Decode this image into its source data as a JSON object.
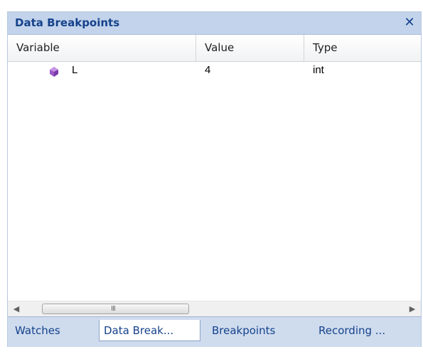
{
  "panel": {
    "title": "Data Breakpoints",
    "close_label": "✕",
    "close_icon": "close-icon"
  },
  "columns": {
    "variable": "Variable",
    "value": "Value",
    "type": "Type"
  },
  "rows": [
    {
      "icon": "purple-variable-icon",
      "variable": "L",
      "value": "4",
      "type": "int"
    }
  ],
  "scrollbar": {
    "left_arrow": "◀",
    "right_arrow": "▶",
    "grip": "III"
  },
  "tabs": [
    {
      "label": "Watches",
      "active": false
    },
    {
      "label": "Data Break...",
      "active": true
    },
    {
      "label": "Breakpoints",
      "active": false
    },
    {
      "label": "Recording ...",
      "active": false
    }
  ],
  "colors": {
    "title_bar": "#c2d3eb",
    "title_text": "#15428b",
    "tab_strip": "#cfdcee",
    "variable_icon": "#9b59c7"
  }
}
